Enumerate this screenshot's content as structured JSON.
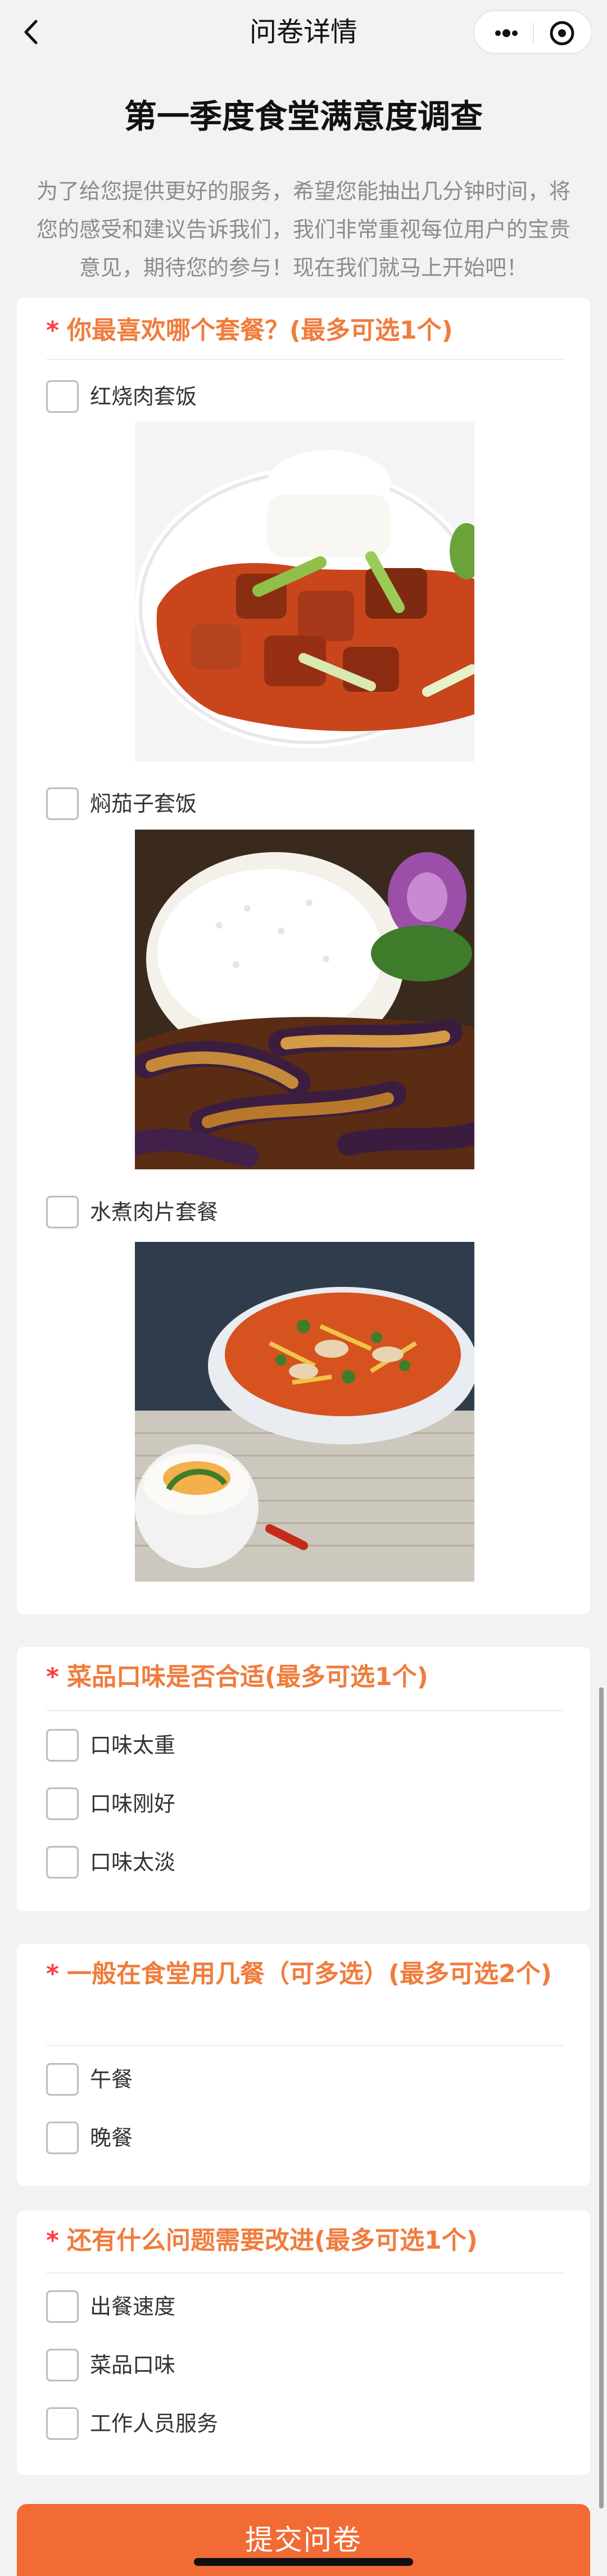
{
  "nav": {
    "title": "问卷详情"
  },
  "survey": {
    "title": "第一季度食堂满意度调查",
    "description": "为了给您提供更好的服务，希望您能抽出几分钟时间，将您的感受和建议告诉我们，我们非常重视每位用户的宝贵意见，期待您的参与！现在我们就马上开始吧！"
  },
  "questions": [
    {
      "required_mark": "*",
      "title": "你最喜欢哪个套餐？(最多可选1个)",
      "options": [
        "红烧肉套饭",
        "焖茄子套饭",
        "水煮肉片套餐"
      ],
      "images": [
        "braised-pork-rice",
        "braised-eggplant-rice",
        "boiled-pork-slices"
      ]
    },
    {
      "required_mark": "*",
      "title": "菜品口味是否合适(最多可选1个)",
      "options": [
        "口味太重",
        "口味刚好",
        "口味太淡"
      ]
    },
    {
      "required_mark": "*",
      "title": "一般在食堂用几餐（可多选）(最多可选2个)",
      "options": [
        "午餐",
        "晚餐"
      ]
    },
    {
      "required_mark": "*",
      "title": "还有什么问题需要改进(最多可选1个)",
      "options": [
        "出餐速度",
        "菜品口味",
        "工作人员服务"
      ]
    }
  ],
  "submit_label": "提交问卷",
  "colors": {
    "accent": "#f07c3c",
    "required": "#ff3b3b",
    "submit": "#f26a34",
    "page_bg": "#f2f2f2"
  },
  "icons": [
    "back-arrow-icon",
    "more-dots-icon",
    "close-target-icon"
  ]
}
